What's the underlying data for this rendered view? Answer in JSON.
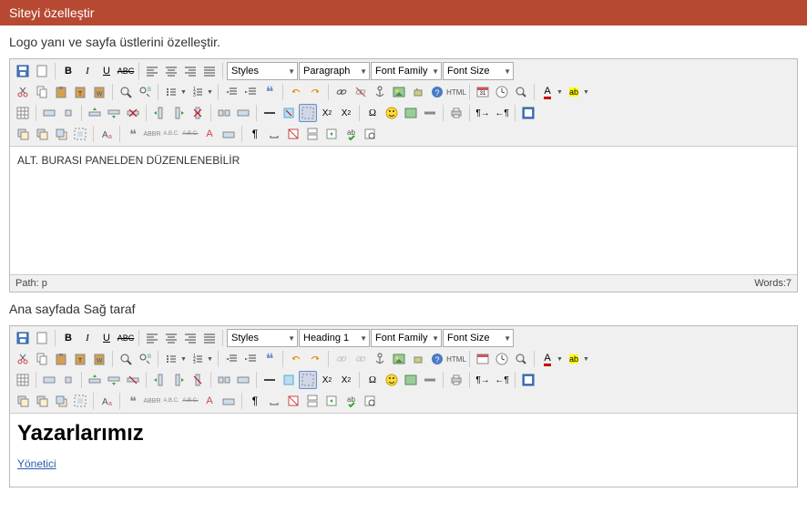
{
  "header": {
    "title": "Siteyi özelleştir"
  },
  "editor1": {
    "section_title": "Logo yanı ve sayfa üstlerini özelleştir.",
    "dropdowns": {
      "styles": "Styles",
      "paragraph": "Paragraph",
      "font_family": "Font Family",
      "font_size": "Font Size"
    },
    "content": "ALT. BURASI PANELDEN DÜZENLENEBİLİR",
    "status": {
      "path": "Path: p",
      "words": "Words:7"
    }
  },
  "editor2": {
    "section_title": "Ana sayfada Sağ taraf",
    "dropdowns": {
      "styles": "Styles",
      "paragraph": "Heading 1",
      "font_family": "Font Family",
      "font_size": "Font Size"
    },
    "heading": "Yazarlarımız",
    "link": "Yönetici"
  },
  "icons": {
    "save": "save",
    "new": "new",
    "bold": "B",
    "italic": "I",
    "underline": "U",
    "strike": "ABC",
    "alignleft": "≡",
    "aligncenter": "≡",
    "alignright": "≡",
    "alignjustify": "≡",
    "cut": "✂",
    "copy": "⎘",
    "paste": "📋",
    "pastetext": "📋",
    "pasteword": "📋",
    "search": "🔍",
    "replace": "🔍",
    "ul": "•",
    "ol": "1.",
    "outdent": "⇤",
    "indent": "⇥",
    "quote": "❝",
    "undo": "↶",
    "redo": "↷",
    "link": "🔗",
    "unlink": "⛓",
    "anchor": "⚓",
    "image": "🖼",
    "code": "⚙",
    "html": "HTML",
    "date": "📅",
    "time": "🕐",
    "preview": "🔍",
    "color": "A",
    "bgcolor": "ab",
    "table": "▦",
    "hr": "—",
    "removefmt": "⌫",
    "sub": "X₂",
    "sup": "X²",
    "char": "Ω",
    "emoji": "😊",
    "media": "🎬",
    "pagebreak": "—",
    "print": "🖨",
    "ltr": "¶",
    "rtl": "¶",
    "full": "⛶",
    "l1": "⬚",
    "l2": "⬚",
    "l3": "⬚",
    "abs": "⊞",
    "ins": "+|",
    "del": "-|",
    "attr": "Aₐ",
    "abbr": "ABBR",
    "acr": "A.B.C",
    "rep": "A.B.C",
    "style": "A",
    "cite": "❝",
    "vis": "¶",
    "nb": "⎵",
    "tpl": "▭",
    "x": "✖",
    "pb": "▭",
    "sp": "✓",
    "sp2": "🔍"
  }
}
